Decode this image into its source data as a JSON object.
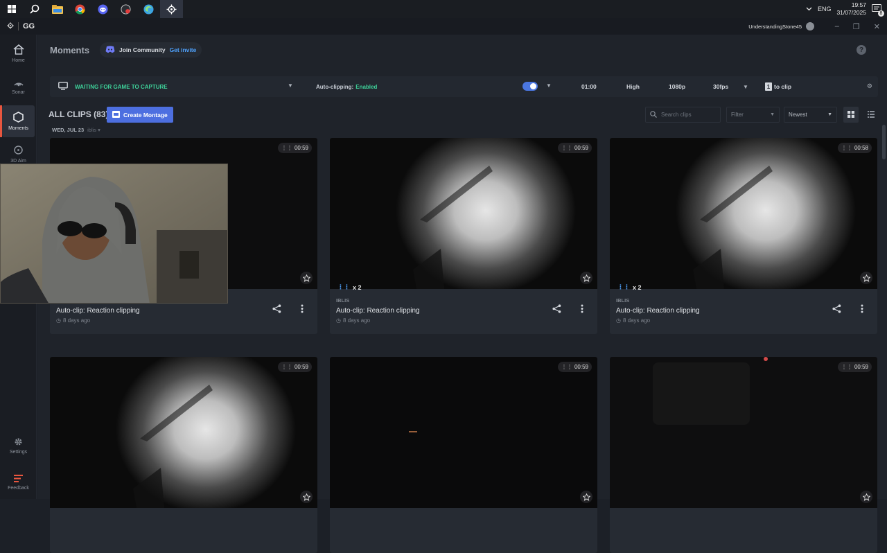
{
  "taskbar": {
    "language": "ENG",
    "time": "19:57",
    "date": "31/07/2025",
    "notif_count": "8"
  },
  "app": {
    "logo_text": "GG",
    "username": "UnderstandingStone45"
  },
  "sidebar": {
    "items": [
      {
        "label": "Home"
      },
      {
        "label": "Sonar"
      },
      {
        "label": "Moments"
      },
      {
        "label": "3D Aim"
      },
      {
        "label": "Settings"
      },
      {
        "label": "Feedback"
      }
    ]
  },
  "header": {
    "title": "Moments",
    "community_label": "Join Community",
    "invite_label": "Get invite"
  },
  "capture": {
    "status": "WAITING FOR GAME TO CAPTURE",
    "autoclip_label": "Auto-clipping:",
    "autoclip_value": "Enabled",
    "duration": "01:00",
    "quality": "High",
    "resolution": "1080p",
    "fps": "30fps",
    "hotkey": "1",
    "hotkey_suffix": "to clip"
  },
  "clips": {
    "header": "ALL CLIPS (83)",
    "create_label": "Create Montage",
    "date_label": "WED, JUL 23",
    "date_game": "iblis",
    "search_placeholder": "Search clips",
    "filter_label": "Filter",
    "sort_label": "Newest",
    "cards": [
      {
        "duration": "00:59",
        "game": "",
        "title": "Auto-clip: Reaction clipping",
        "age": "8 days ago",
        "reactions": ""
      },
      {
        "duration": "00:59",
        "game": "IBLIS",
        "title": "Auto-clip: Reaction clipping",
        "age": "8 days ago",
        "reactions": "x 2"
      },
      {
        "duration": "00:58",
        "game": "IBLIS",
        "title": "Auto-clip: Reaction clipping",
        "age": "8 days ago",
        "reactions": "x 2"
      },
      {
        "duration": "00:59"
      },
      {
        "duration": "00:59"
      },
      {
        "duration": "00:59"
      }
    ]
  },
  "colors": {
    "accent_green": "#3ed29a",
    "accent_blue": "#4d6fe0",
    "active_marker": "#e8563f"
  }
}
